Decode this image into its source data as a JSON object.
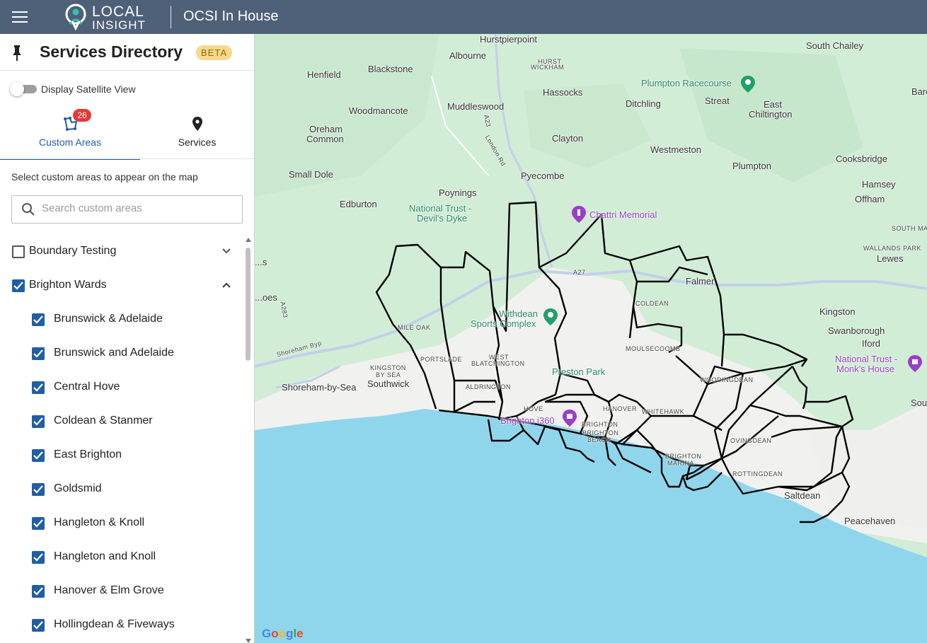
{
  "header": {
    "logo_line1": "LOCAL",
    "logo_line2": "INSIGHT",
    "app_title": "OCSI In House",
    "menu_icon": "hamburger-menu-icon"
  },
  "sidebar": {
    "title": "Services Directory",
    "beta_label": "BETA",
    "pin_icon": "pin-icon",
    "satellite_label": "Display Satellite View",
    "satellite_on": false,
    "tabs": [
      {
        "label": "Custom Areas",
        "badge": "26",
        "icon": "custom-areas-icon",
        "active": true
      },
      {
        "label": "Services",
        "icon": "location-pin-icon",
        "active": false
      }
    ],
    "instructions": "Select custom areas to appear on the map",
    "search_placeholder": "Search custom areas",
    "search_value": "",
    "groups": [
      {
        "label": "Boundary Testing",
        "checked": false,
        "expanded": false
      },
      {
        "label": "Brighton Wards",
        "checked": true,
        "expanded": true
      }
    ],
    "wards": [
      {
        "label": "Brunswick & Adelaide",
        "checked": true
      },
      {
        "label": "Brunswick and Adelaide",
        "checked": true
      },
      {
        "label": "Central Hove",
        "checked": true
      },
      {
        "label": "Coldean & Stanmer",
        "checked": true
      },
      {
        "label": "East Brighton",
        "checked": true
      },
      {
        "label": "Goldsmid",
        "checked": true
      },
      {
        "label": "Hangleton & Knoll",
        "checked": true
      },
      {
        "label": "Hangleton and Knoll",
        "checked": true
      },
      {
        "label": "Hanover & Elm Grove",
        "checked": true
      },
      {
        "label": "Hollingdean & Fiveways",
        "checked": true
      }
    ]
  },
  "map": {
    "attribution": "Google",
    "colors": {
      "land": "#d2edd6",
      "sea": "#8fd6ec",
      "urban": "#f3f3f1",
      "road": "#c2d0ea"
    },
    "places": [
      {
        "name": "Hurstpierpoint"
      },
      {
        "name": "Albourne"
      },
      {
        "name": "HURST"
      },
      {
        "name": "WICKHAM"
      },
      {
        "name": "South Chailey"
      },
      {
        "name": "Henfield"
      },
      {
        "name": "Blackstone"
      },
      {
        "name": "Hassocks"
      },
      {
        "name": "Plumpton Racecourse"
      },
      {
        "name": "Barcombe"
      },
      {
        "name": "Ditchling"
      },
      {
        "name": "Streat"
      },
      {
        "name": "East"
      },
      {
        "name": "Chiltington"
      },
      {
        "name": "Woodmancote"
      },
      {
        "name": "Muddleswood"
      },
      {
        "name": "Oreham"
      },
      {
        "name": "Common"
      },
      {
        "name": "Clayton"
      },
      {
        "name": "Westmeston"
      },
      {
        "name": "Cooksbridge"
      },
      {
        "name": "Plumpton"
      },
      {
        "name": "Small Dole"
      },
      {
        "name": "Pyecombe"
      },
      {
        "name": "Hamsey"
      },
      {
        "name": "Offham"
      },
      {
        "name": "Poynings"
      },
      {
        "name": "Edburton"
      },
      {
        "name": "National Trust -"
      },
      {
        "name": "Devil's Dyke"
      },
      {
        "name": "Chattri Memorial"
      },
      {
        "name": "SOUTH MALLING"
      },
      {
        "name": "WALLANDS PARK"
      },
      {
        "name": "Lewes"
      },
      {
        "name": "Falmer"
      },
      {
        "name": "Kingston"
      },
      {
        "name": "Swanborough"
      },
      {
        "name": "Iford"
      },
      {
        "name": "Withdean"
      },
      {
        "name": "Sports Complex"
      },
      {
        "name": "MILE OAK"
      },
      {
        "name": "PORTSLADE"
      },
      {
        "name": "KINGSTON"
      },
      {
        "name": "BY SEA"
      },
      {
        "name": "Shoreham-by-Sea"
      },
      {
        "name": "Southwick"
      },
      {
        "name": "WEST"
      },
      {
        "name": "BLATCHINGTON"
      },
      {
        "name": "Preston Park"
      },
      {
        "name": "MOULSECOOMB"
      },
      {
        "name": "COLDEAN"
      },
      {
        "name": "WOODINGDEAN"
      },
      {
        "name": "National Trust -"
      },
      {
        "name": "Monk's House"
      },
      {
        "name": "ALDRINGTON"
      },
      {
        "name": "HOVE"
      },
      {
        "name": "HANOVER"
      },
      {
        "name": "WHITEHAWK"
      },
      {
        "name": "Brighton i360"
      },
      {
        "name": "BRIGHTON"
      },
      {
        "name": "BRIGHTON"
      },
      {
        "name": "BEACH"
      },
      {
        "name": "OVINGDEAN"
      },
      {
        "name": "BRIGHTON"
      },
      {
        "name": "MARINA"
      },
      {
        "name": "ROTTINGDEAN"
      },
      {
        "name": "Saltdean"
      },
      {
        "name": "Peacehaven"
      },
      {
        "name": "Southease"
      },
      {
        "name": "Shoreham Byp"
      },
      {
        "name": "A27"
      },
      {
        "name": "A23"
      },
      {
        "name": "London Rd"
      },
      {
        "name": "A283"
      },
      {
        "name": "...s"
      },
      {
        "name": "...oes"
      }
    ]
  }
}
